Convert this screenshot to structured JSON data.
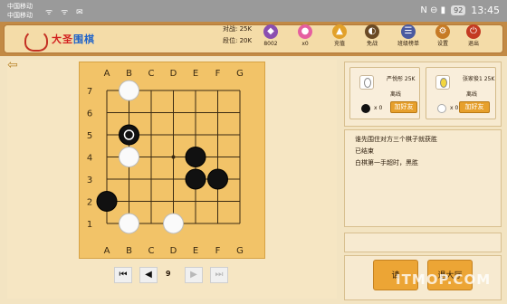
{
  "status_bar": {
    "carrier1": "中国移动",
    "carrier2": "中国移动",
    "glyphs": "ᯤ ᯤ ✉",
    "right_icons": "N ⊖ ▮",
    "battery": "92",
    "time": "13:45"
  },
  "header": {
    "logo_text": "大圣",
    "logo_sub": "围棋",
    "record_line1_label": "对战:",
    "record_line1_value": "25K",
    "record_line2_label": "段位:",
    "record_line2_value": "20K",
    "buttons": [
      {
        "label": "8002",
        "icon": "gem-icon",
        "glyph": "◆",
        "color": "#8b4fb0"
      },
      {
        "label": "x0",
        "icon": "egg-icon",
        "glyph": "●",
        "color": "#e55fa0"
      },
      {
        "label": "充值",
        "icon": "mushroom-icon",
        "glyph": "▲",
        "color": "#e2a12a"
      },
      {
        "label": "免战",
        "icon": "shield-icon",
        "glyph": "◐",
        "color": "#6a4a25"
      },
      {
        "label": "班级榜单",
        "icon": "leaderboard-icon",
        "glyph": "☰",
        "color": "#4a5aa0"
      },
      {
        "label": "设置",
        "icon": "gear-icon",
        "glyph": "⚙",
        "color": "#c67a25"
      },
      {
        "label": "退出",
        "icon": "power-icon",
        "glyph": "⏻",
        "color": "#c43a22"
      }
    ]
  },
  "board": {
    "columns": [
      "A",
      "B",
      "C",
      "D",
      "E",
      "F",
      "G"
    ],
    "rows": [
      "7",
      "6",
      "5",
      "4",
      "3",
      "2",
      "1"
    ]
  },
  "controls": {
    "first": "⏮",
    "prev": "◀",
    "move_number": "9",
    "next": "▶",
    "last": "⏭"
  },
  "players": [
    {
      "name": "严悦彤 25K",
      "status": "离线",
      "stone": "black",
      "captures": "x 0",
      "avatar": "egg-icon"
    },
    {
      "name": "张家俊1 25K",
      "status": "离线",
      "stone": "white",
      "captures": "x 0",
      "avatar": "egg-icon",
      "add_friend": "加好友"
    }
  ],
  "player0_add_friend": "加好友",
  "chat": [
    "谁先围住对方三个棋子就获胜",
    "已结束",
    "白棋第一手超时，黑胜"
  ],
  "bottom_buttons": [
    "请",
    "退大厅"
  ],
  "watermark": "ITMOP.COM",
  "colors": {
    "board": "#f2c368",
    "accent": "#eca535",
    "header": "#c28a45"
  }
}
